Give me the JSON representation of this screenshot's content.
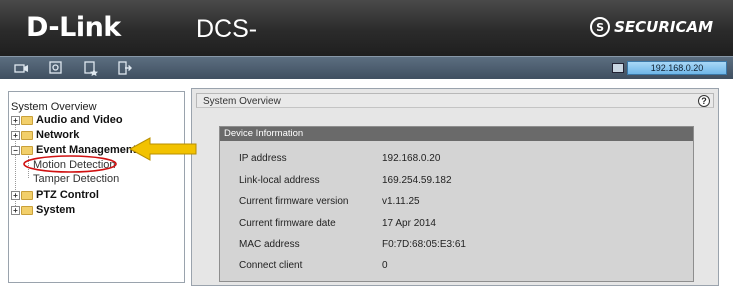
{
  "header": {
    "brand": "D-Link",
    "model": "DCS-",
    "product_logo": "SECURICAM"
  },
  "toolbar": {
    "icons": [
      "camera-icon",
      "setup-icon",
      "maintenance-icon",
      "logout-icon"
    ],
    "ip_address": "192.168.0.20"
  },
  "sidebar": {
    "title": "System Overview",
    "items": [
      {
        "label": "Audio and Video"
      },
      {
        "label": "Network"
      },
      {
        "label": "Event Management",
        "children": [
          "Motion Detection",
          "Tamper Detection"
        ]
      },
      {
        "label": "PTZ Control"
      },
      {
        "label": "System"
      }
    ]
  },
  "main": {
    "panel_title": "System Overview",
    "help": "?",
    "card_title": "Device Information",
    "rows": [
      {
        "label": "IP address",
        "value": "192.168.0.20"
      },
      {
        "label": "Link-local address",
        "value": "169.254.59.182"
      },
      {
        "label": "Current firmware version",
        "value": "v1.11.25"
      },
      {
        "label": "Current firmware date",
        "value": "17 Apr 2014"
      },
      {
        "label": "MAC address",
        "value": "F0:7D:68:05:E3:61"
      },
      {
        "label": "Connect client",
        "value": "0"
      }
    ]
  },
  "colors": {
    "header_bg": "#2b2b2b",
    "toolbar_bg": "#4b5b6c",
    "ip_box": "#8cc8f0",
    "card_header": "#6a6a6a",
    "annotation_arrow": "#f2c200",
    "annotation_ellipse": "#d01010"
  }
}
